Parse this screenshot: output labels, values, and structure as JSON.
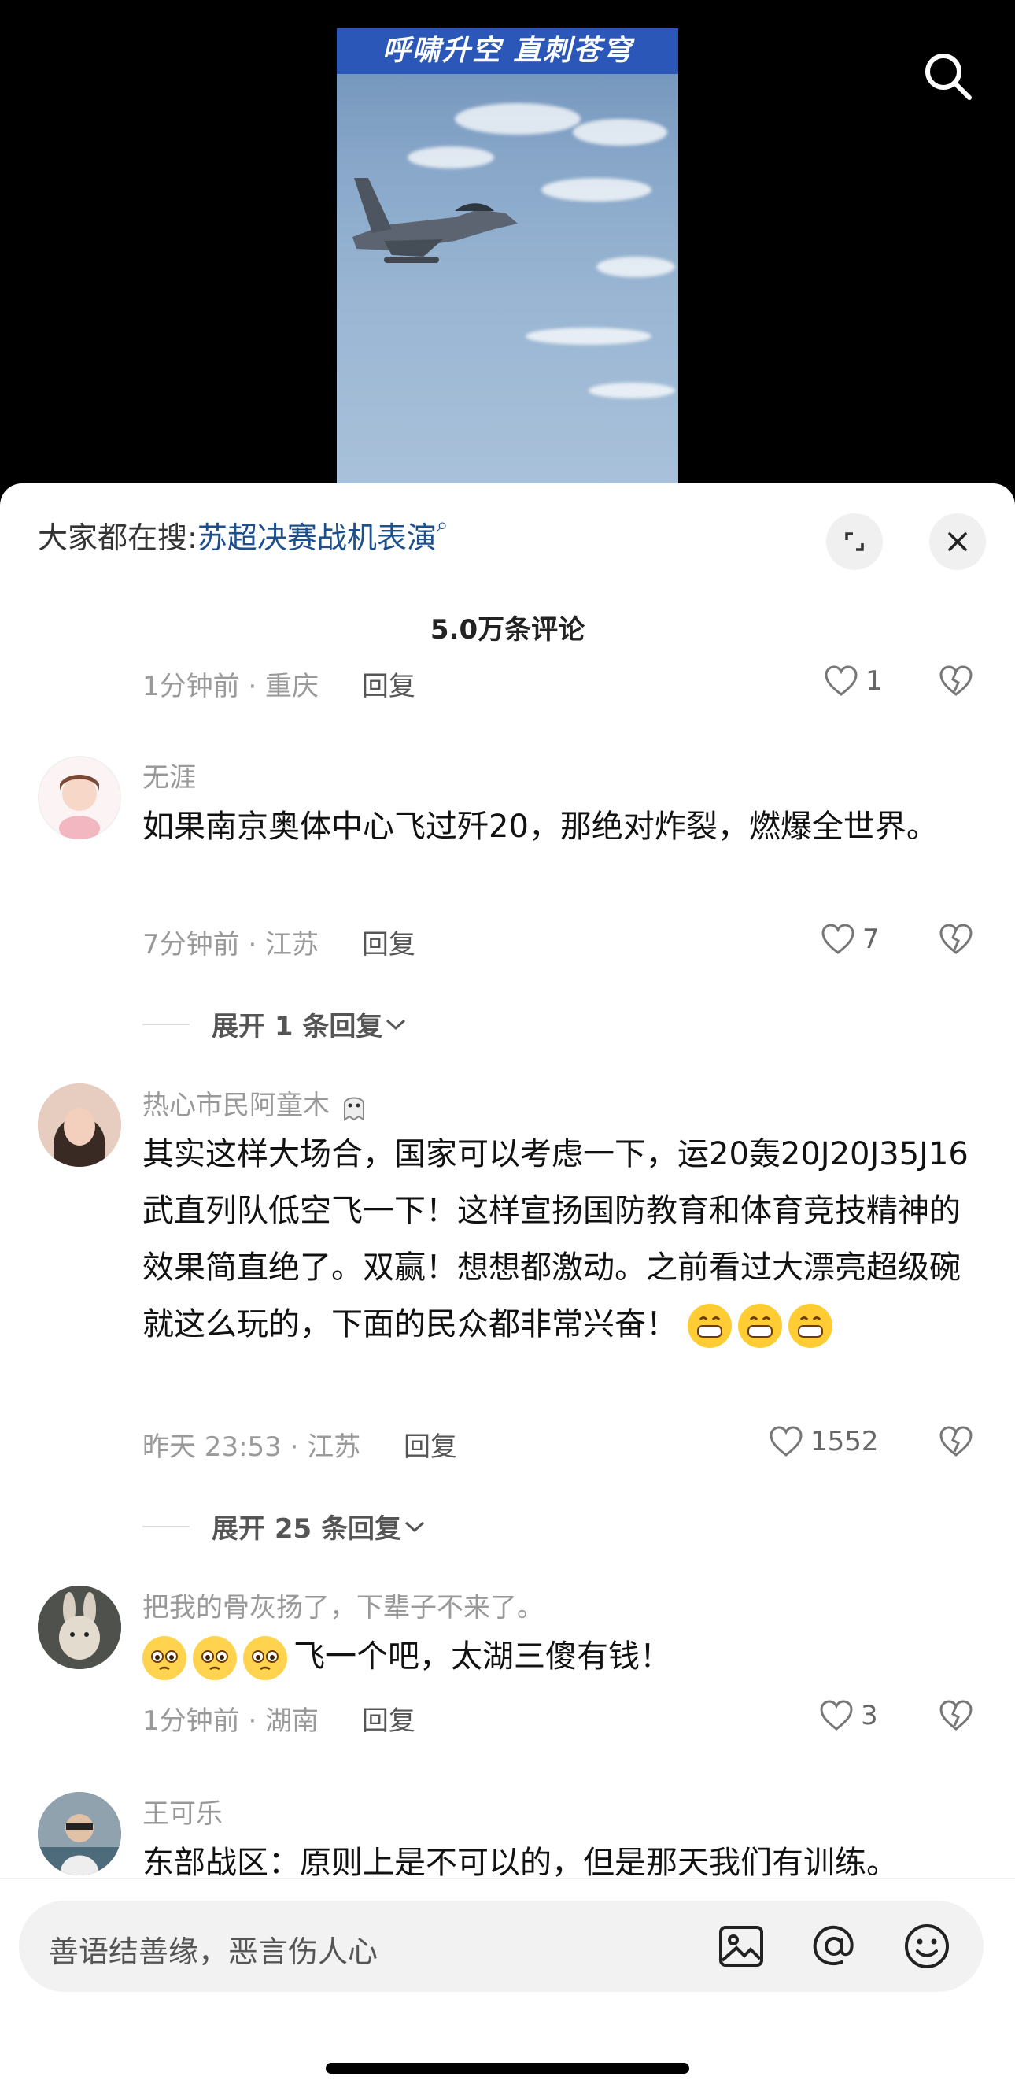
{
  "video": {
    "caption": "呼啸升空 直刺苍穹"
  },
  "hot_search": {
    "prefix": "大家都在搜:",
    "term": "苏超决赛战机表演"
  },
  "comment_count": "5.0万条评论",
  "reply_label": "回复",
  "partial_comment": {
    "time_location": "1分钟前 · 重庆",
    "likes": "1"
  },
  "comments": [
    {
      "name": "无涯",
      "text": "如果南京奥体中心飞过歼20，那绝对炸裂，燃爆全世界。",
      "time_location": "7分钟前 · 江苏",
      "likes": "7",
      "expand": "展开 1 条回复"
    },
    {
      "name": "热心市民阿童木",
      "text": "其实这样大场合，国家可以考虑一下，运20轰20J20J35J16武直列队低空飞一下！这样宣扬国防教育和体育竞技精神的效果简直绝了。双赢！想想都激动。之前看过大漂亮超级碗就这么玩的，下面的民众都非常兴奋！",
      "time_location": "昨天 23:53 · 江苏",
      "likes": "1552",
      "expand": "展开 25 条回复"
    },
    {
      "name": "把我的骨灰扬了，下辈子不来了。",
      "text": "飞一个吧，太湖三傻有钱！",
      "time_location": "1分钟前 · 湖南",
      "likes": "3"
    },
    {
      "name": "王可乐",
      "text": "东部战区：原则上是不可以的，但是那天我们有训练。"
    }
  ],
  "input": {
    "placeholder": "善语结善缘，恶言伤人心"
  },
  "icons": {
    "search": "search-icon",
    "expand": "expand-icon",
    "close": "close-icon",
    "heart": "heart-icon",
    "broken_heart": "broken-heart-icon",
    "image": "image-icon",
    "at": "at-icon",
    "emoji": "emoji-icon"
  }
}
